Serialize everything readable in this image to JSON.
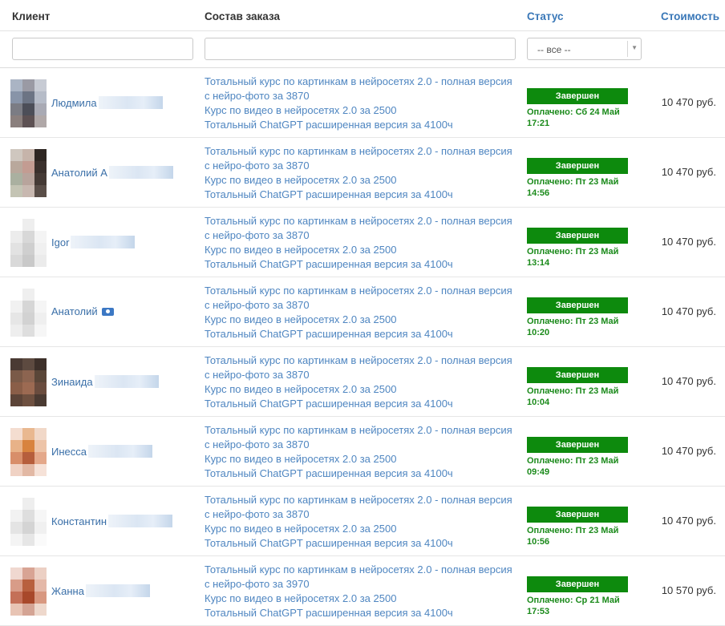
{
  "headers": {
    "client": "Клиент",
    "order": "Состав заказа",
    "status": "Статус",
    "cost": "Стоимость"
  },
  "filters": {
    "client_value": "",
    "order_value": "",
    "status_value": "-- все --"
  },
  "colors": {
    "link": "#4f86c1",
    "status_badge": "#0d8a0d",
    "paid_text": "#1a8a1a",
    "header_link": "#3a78b8"
  },
  "rows": [
    {
      "name": "Людмила",
      "order": [
        "Тотальный курс по картинкам в нейросетях 2.0 - полная версия",
        "с нейро-фото за 3870",
        "Курс по видео в нейросетях 2.0 за 2500",
        "Тотальный ChatGPT расширенная версия за 4100ч"
      ],
      "status": "Завершен",
      "paid": "Оплачено: Сб 24 Май 17:21",
      "cost": "10 470 руб."
    },
    {
      "name": "Анатолий А",
      "order": [
        "Тотальный курс по картинкам в нейросетях 2.0 - полная версия",
        "с нейро-фото за 3870",
        "Курс по видео в нейросетях 2.0 за 2500",
        "Тотальный ChatGPT расширенная версия за 4100ч"
      ],
      "status": "Завершен",
      "paid": "Оплачено: Пт 23 Май 14:56",
      "cost": "10 470 руб."
    },
    {
      "name": "Igor",
      "order": [
        "Тотальный курс по картинкам в нейросетях 2.0 - полная версия",
        "с нейро-фото за 3870",
        "Курс по видео в нейросетях 2.0 за 2500",
        "Тотальный ChatGPT расширенная версия за 4100ч"
      ],
      "status": "Завершен",
      "paid": "Оплачено: Пт 23 Май 13:14",
      "cost": "10 470 руб."
    },
    {
      "name": "Анатолий",
      "order": [
        "Тотальный курс по картинкам в нейросетях 2.0 - полная версия",
        "с нейро-фото за 3870",
        "Курс по видео в нейросетях 2.0 за 2500",
        "Тотальный ChatGPT расширенная версия за 4100ч"
      ],
      "status": "Завершен",
      "paid": "Оплачено: Пт 23 Май 10:20",
      "cost": "10 470 руб."
    },
    {
      "name": "Зинаида",
      "order": [
        "Тотальный курс по картинкам в нейросетях 2.0 - полная версия",
        "с нейро-фото за 3870",
        "Курс по видео в нейросетях 2.0 за 2500",
        "Тотальный ChatGPT расширенная версия за 4100ч"
      ],
      "status": "Завершен",
      "paid": "Оплачено: Пт 23 Май 10:04",
      "cost": "10 470 руб."
    },
    {
      "name": "Инесса",
      "order": [
        "Тотальный курс по картинкам в нейросетях 2.0 - полная версия",
        "с нейро-фото за 3870",
        "Курс по видео в нейросетях 2.0 за 2500",
        "Тотальный ChatGPT расширенная версия за 4100ч"
      ],
      "status": "Завершен",
      "paid": "Оплачено: Пт 23 Май 09:49",
      "cost": "10 470 руб."
    },
    {
      "name": "Константин",
      "order": [
        "Тотальный курс по картинкам в нейросетях 2.0 - полная версия",
        "с нейро-фото за 3870",
        "Курс по видео в нейросетях 2.0 за 2500",
        "Тотальный ChatGPT расширенная версия за 4100ч"
      ],
      "status": "Завершен",
      "paid": "Оплачено: Пт 23 Май 10:56",
      "cost": "10 470 руб."
    },
    {
      "name": "Жанна",
      "order": [
        "Тотальный курс по картинкам в нейросетях 2.0 - полная версия",
        "с нейро-фото за 3970",
        "Курс по видео в нейросетях 2.0 за 2500",
        "Тотальный ChatGPT расширенная версия за 4100ч"
      ],
      "status": "Завершен",
      "paid": "Оплачено: Ср 21 Май 17:53",
      "cost": "10 570 руб."
    }
  ]
}
